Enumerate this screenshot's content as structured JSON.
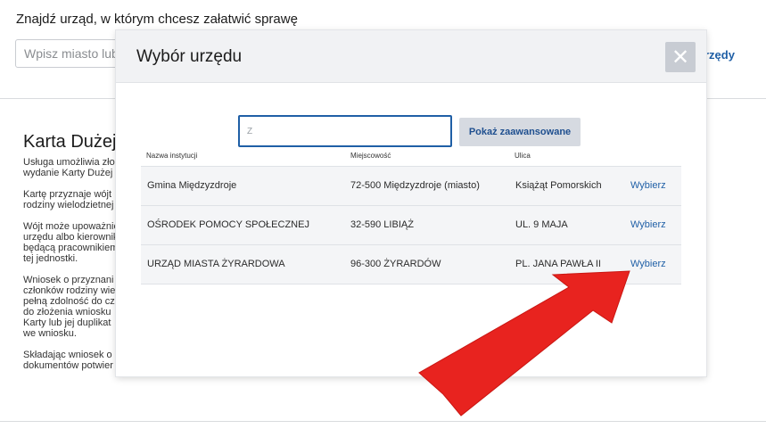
{
  "page": {
    "heading": "Znajdź urząd, w którym chcesz załatwić sprawę",
    "search_placeholder": "Wpisz miasto lub",
    "right_link": "rzędy",
    "section_title": "Karta Dużej",
    "paragraphs": [
      [
        "Usługa umożliwia zło",
        "wydanie Karty Dużej"
      ],
      [
        "Kartę przyznaje wójt",
        "rodziny wielodzietnej"
      ],
      [
        "Wójt może upoważnić",
        "urzędu albo kierownik",
        "będącą pracownikiem",
        "tej jednostki."
      ],
      [
        "Wniosek o przyznani",
        "członków rodziny wie",
        "pełną zdolność do cz",
        "do złożenia wniosku",
        "Karty lub jej duplikat",
        "we wniosku."
      ],
      [
        "Składając wniosek o",
        "dokumentów potwier"
      ]
    ]
  },
  "modal": {
    "title": "Wybór urzędu",
    "close_symbol": "✕",
    "search_placeholder": "Ż",
    "advanced_button": "Pokaż zaawansowane",
    "columns": [
      "Nazwa instytucji",
      "Miejscowość",
      "Ulica"
    ],
    "rows": [
      {
        "name": "Gmina Międzyzdroje",
        "city": "72-500 Międzyzdroje (miasto)",
        "street": "Książąt Pomorskich",
        "action": "Wybierz"
      },
      {
        "name": "OŚRODEK POMOCY SPOŁECZNEJ",
        "city": "32-590 LIBIĄŻ",
        "street": "UL. 9 MAJA",
        "action": "Wybierz"
      },
      {
        "name": "URZĄD MIASTA ŻYRARDOWA",
        "city": "96-300 ŻYRARDÓW",
        "street": "PL. JANA PAWŁA II",
        "action": "Wybierz"
      }
    ]
  },
  "annotation": {
    "arrow_color": "#e8231f",
    "arrow_icon": "red-pointer-arrow-icon"
  }
}
